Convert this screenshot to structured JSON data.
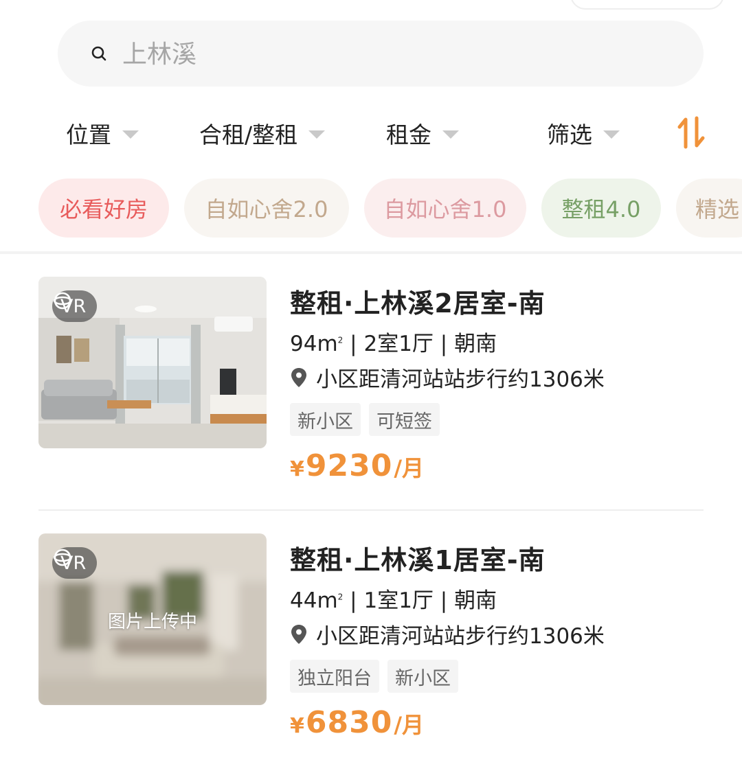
{
  "search": {
    "placeholder": "上林溪"
  },
  "filters": [
    {
      "label": "位置"
    },
    {
      "label": "合租/整租"
    },
    {
      "label": "租金"
    },
    {
      "label": "筛选"
    }
  ],
  "chips": [
    {
      "label": "必看好房",
      "bg": "#fdeaea",
      "color": "#e85b5b"
    },
    {
      "label": "自如心舍2.0",
      "bg": "#f8f5f1",
      "color": "#c2a88d"
    },
    {
      "label": "自如心舍1.0",
      "bg": "#fbeeee",
      "color": "#dc9aa0"
    },
    {
      "label": "整租4.0",
      "bg": "#eef4ea",
      "color": "#77a066"
    },
    {
      "label": "精选",
      "bg": "#f8f5f1",
      "color": "#c2a88d"
    }
  ],
  "listings": [
    {
      "vr": "VR",
      "title": "整租·上林溪2居室-南",
      "area": "94",
      "area_unit": "m",
      "area_sup": "2",
      "layout": "2室1厅",
      "orientation": "朝南",
      "location": "小区距清河站站步行约1306米",
      "tags": [
        "新小区",
        "可短签"
      ],
      "currency": "¥",
      "price": "9230",
      "unit": "/月",
      "photo_status": ""
    },
    {
      "vr": "VR",
      "title": "整租·上林溪1居室-南",
      "area": "44",
      "area_unit": "m",
      "area_sup": "2",
      "layout": "1室1厅",
      "orientation": "朝南",
      "location": "小区距清河站站步行约1306米",
      "tags": [
        "独立阳台",
        "新小区"
      ],
      "currency": "¥",
      "price": "6830",
      "unit": "/月",
      "photo_status": "图片上传中"
    }
  ],
  "icons": {
    "search": "search-icon",
    "caret": "caret-down-icon",
    "sort": "sort-icon",
    "vr": "vr-icon",
    "pin": "location-pin-icon"
  },
  "colors": {
    "accent": "#f0923a",
    "caret": "#c9c9c9"
  }
}
